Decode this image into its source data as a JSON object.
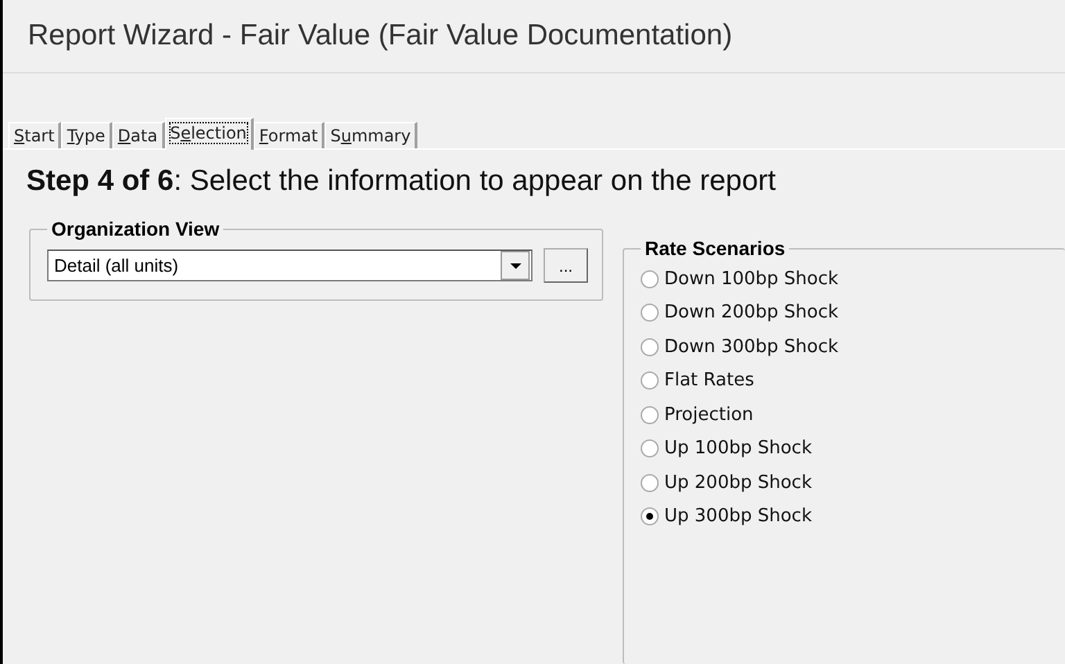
{
  "window": {
    "title": "Report Wizard - Fair Value (Fair Value Documentation)"
  },
  "tabs": [
    {
      "key": "S",
      "after": "tart",
      "selected": false
    },
    {
      "key": "T",
      "after": "ype",
      "selected": false
    },
    {
      "key": "D",
      "after": "ata",
      "selected": false
    },
    {
      "before": "S",
      "key": "e",
      "after": "lection",
      "selected": true
    },
    {
      "key": "F",
      "after": "ormat",
      "selected": false
    },
    {
      "before": "S",
      "key": "u",
      "after": "mmary",
      "selected": false
    }
  ],
  "heading": "**Step 4 of 6**: Select the information to appear on the report",
  "organization_view": {
    "legend": "Organization View",
    "value": "Detail (all units)",
    "browse_button": "..."
  },
  "rate_scenarios": {
    "legend": "Rate Scenarios",
    "options": [
      {
        "label": "Down 100bp Shock",
        "selected": false
      },
      {
        "label": "Down 200bp Shock",
        "selected": false
      },
      {
        "label": "Down 300bp Shock",
        "selected": false
      },
      {
        "label": "Flat Rates",
        "selected": false
      },
      {
        "label": "Projection",
        "selected": false
      },
      {
        "label": "Up 100bp Shock",
        "selected": false
      },
      {
        "label": "Up 200bp Shock",
        "selected": false
      },
      {
        "label": "Up 300bp Shock",
        "selected": true
      }
    ]
  }
}
